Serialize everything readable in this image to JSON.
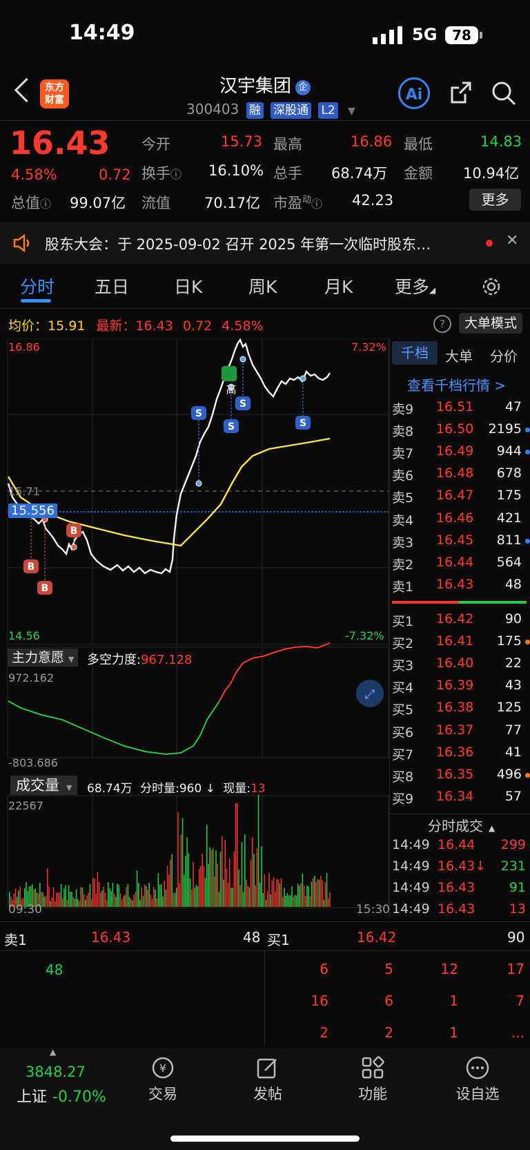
{
  "status": {
    "time": "14:49",
    "network": "5G",
    "battery": "78"
  },
  "header": {
    "logo_line1": "东方",
    "logo_line2": "财富",
    "title": "汉宇集团",
    "qi_badge": "企",
    "code": "300403",
    "tag_rong": "融",
    "tag_sgt": "深股通",
    "tag_l2": "L2",
    "ai_label": "Ai"
  },
  "quote": {
    "price": "16.43",
    "pct": "4.58%",
    "chg": "0.72",
    "open_label": "今开",
    "open": "15.73",
    "high_label": "最高",
    "high": "16.86",
    "low_label": "最低",
    "low": "14.83",
    "turnover_label": "换手",
    "turnover": "16.10%",
    "volume_label": "总手",
    "volume": "68.74万",
    "amount_label": "金额",
    "amount": "10.94亿",
    "mktcap_label": "总值",
    "mktcap": "99.07亿",
    "float_label": "流值",
    "float": "70.17亿",
    "pe_label": "市盈",
    "pe_sup": "动",
    "pe": "42.23",
    "more_button": "更多"
  },
  "notice": {
    "text": "股东大会：于 2025-09-02 召开 2025 年第一次临时股东…"
  },
  "tabs": [
    "分时",
    "五日",
    "日K",
    "周K",
    "月K",
    "更多"
  ],
  "info_line": {
    "avg_label": "均价：",
    "avg": "15.91",
    "last_label": "最新：",
    "last": "16.43",
    "chg": "0.72",
    "pct": "4.58%",
    "big_order_mode": "大单模式"
  },
  "chart": {
    "y_top": "16.86",
    "y_bottom": "14.56",
    "pct_top": "7.32%",
    "pct_bottom": "-7.32%",
    "ref_price": "15.71",
    "cursor_price": "15.556",
    "high_marker": "高",
    "x_start": "09:30",
    "x_end": "15:30",
    "indicator_label": "主力意愿",
    "power_label": "多空力度:",
    "power_value": "967.128",
    "ind_top": "972.162",
    "ind_bottom": "-803.686",
    "vol_label": "成交量",
    "vol_total": "68.74万",
    "vol_min_label": "分时量:",
    "vol_min": "960 ↓",
    "vol_now_label": "现量:",
    "vol_now": "13",
    "vol_top": "22567"
  },
  "chart_data": {
    "type": "line",
    "x": [
      "09:30",
      "15:30"
    ],
    "series": [],
    "ylim": [
      14.56,
      16.86
    ],
    "indicator_ylim": [
      -803.686,
      972.162
    ],
    "volume_ylim": [
      0,
      22567
    ]
  },
  "depth": {
    "tabs": [
      "千档",
      "大单",
      "分价"
    ],
    "link": "查看千档行情 >",
    "asks": [
      {
        "label": "卖9",
        "price": "16.51",
        "vol": "47",
        "dot": ""
      },
      {
        "label": "卖8",
        "price": "16.50",
        "vol": "2195",
        "dot": "blue"
      },
      {
        "label": "卖7",
        "price": "16.49",
        "vol": "944",
        "dot": "blue"
      },
      {
        "label": "卖6",
        "price": "16.48",
        "vol": "678",
        "dot": ""
      },
      {
        "label": "卖5",
        "price": "16.47",
        "vol": "175",
        "dot": ""
      },
      {
        "label": "卖4",
        "price": "16.46",
        "vol": "421",
        "dot": ""
      },
      {
        "label": "卖3",
        "price": "16.45",
        "vol": "811",
        "dot": "blue"
      },
      {
        "label": "卖2",
        "price": "16.44",
        "vol": "564",
        "dot": ""
      },
      {
        "label": "卖1",
        "price": "16.43",
        "vol": "48",
        "dot": ""
      }
    ],
    "bids": [
      {
        "label": "买1",
        "price": "16.42",
        "vol": "90",
        "dot": ""
      },
      {
        "label": "买2",
        "price": "16.41",
        "vol": "175",
        "dot": "orange"
      },
      {
        "label": "买3",
        "price": "16.40",
        "vol": "22",
        "dot": ""
      },
      {
        "label": "买4",
        "price": "16.39",
        "vol": "43",
        "dot": ""
      },
      {
        "label": "买5",
        "price": "16.38",
        "vol": "125",
        "dot": ""
      },
      {
        "label": "买6",
        "price": "16.37",
        "vol": "77",
        "dot": ""
      },
      {
        "label": "买7",
        "price": "16.36",
        "vol": "41",
        "dot": ""
      },
      {
        "label": "买8",
        "price": "16.35",
        "vol": "496",
        "dot": "orange"
      },
      {
        "label": "买9",
        "price": "16.34",
        "vol": "57",
        "dot": ""
      }
    ],
    "ticks_title": "分时成交",
    "ticks": [
      {
        "time": "14:49",
        "price": "16.44",
        "vol": "299",
        "dir": "red"
      },
      {
        "time": "14:49",
        "price": "16.43↓",
        "vol": "231",
        "dir": "green"
      },
      {
        "time": "14:49",
        "price": "16.43",
        "vol": "91",
        "dir": "green"
      },
      {
        "time": "14:49",
        "price": "16.43",
        "vol": "13",
        "dir": "red"
      }
    ]
  },
  "queue": {
    "ask_label": "卖1",
    "ask_price": "16.43",
    "ask_vol": "48",
    "bid_label": "买1",
    "bid_price": "16.42",
    "bid_vol": "90",
    "ask_orders": [
      "48"
    ],
    "bid_orders": [
      [
        "6",
        "5",
        "12",
        "17"
      ],
      [
        "16",
        "6",
        "1",
        "7"
      ],
      [
        "2",
        "2",
        "1",
        "..."
      ]
    ]
  },
  "bottom": {
    "index_value": "3848.27",
    "index_name": "上证",
    "index_pct": "-0.70%",
    "nav": [
      "交易",
      "发帖",
      "功能",
      "设自选"
    ]
  }
}
